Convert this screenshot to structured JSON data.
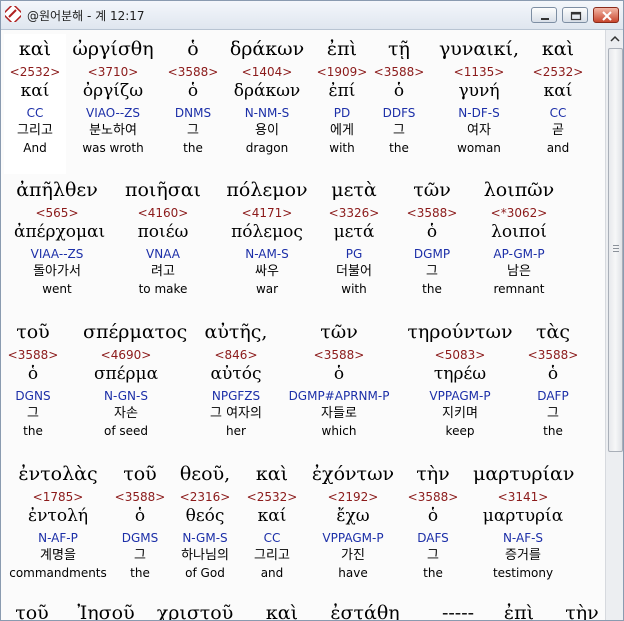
{
  "window": {
    "title": "@원어분해 - 계 12:17",
    "buttons": [
      "minimize",
      "maximize",
      "close"
    ]
  },
  "rows": [
    {
      "words": [
        {
          "greek": "καὶ",
          "strong": "<2532>",
          "lemma": "καί",
          "parse": "CC",
          "korean": "그리고",
          "english": "And",
          "highlight": true
        },
        {
          "greek": "ὠργίσθη",
          "strong": "<3710>",
          "lemma": "ὀργίζω",
          "parse": "VIAO--ZS",
          "korean": "분노하여",
          "english": "was wroth"
        },
        {
          "greek": "ὁ",
          "strong": "<3588>",
          "lemma": "ὁ",
          "parse": "DNMS",
          "korean": "그",
          "english": "the"
        },
        {
          "greek": "δράκων",
          "strong": "<1404>",
          "lemma": "δράκων",
          "parse": "N-NM-S",
          "korean": "용이",
          "english": "dragon"
        },
        {
          "greek": "ἐπὶ",
          "strong": "<1909>",
          "lemma": "ἐπί",
          "parse": "PD",
          "korean": "에게",
          "english": "with"
        },
        {
          "greek": "τῇ",
          "strong": "<3588>",
          "lemma": "ὁ",
          "parse": "DDFS",
          "korean": "그",
          "english": "the"
        },
        {
          "greek": "γυναικί,",
          "strong": "<1135>",
          "lemma": "γυνή",
          "parse": "N-DF-S",
          "korean": "여자",
          "english": "woman"
        },
        {
          "greek": "καὶ",
          "strong": "<2532>",
          "lemma": "καί",
          "parse": "CC",
          "korean": "곧",
          "english": "and"
        }
      ]
    },
    {
      "words": [
        {
          "greek": "ἀπῆλθεν",
          "strong": "<565>",
          "lemma": "ἀπέρχομαι",
          "parse": "VIAA--ZS",
          "korean": "돌아가서",
          "english": "went"
        },
        {
          "greek": "ποιῆσαι",
          "strong": "<4160>",
          "lemma": "ποιέω",
          "parse": "VNAA",
          "korean": "려고",
          "english": "to make"
        },
        {
          "greek": "πόλεμον",
          "strong": "<4171>",
          "lemma": "πόλεμος",
          "parse": "N-AM-S",
          "korean": "싸우",
          "english": "war"
        },
        {
          "greek": "μετὰ",
          "strong": "<3326>",
          "lemma": "μετά",
          "parse": "PG",
          "korean": "더불어",
          "english": "with"
        },
        {
          "greek": "τῶν",
          "strong": "<3588>",
          "lemma": "ὁ",
          "parse": "DGMP",
          "korean": "그",
          "english": "the"
        },
        {
          "greek": "λοιπῶν",
          "strong": "<*3062>",
          "lemma": "λοιποί",
          "parse": "AP-GM-P",
          "korean": "남은",
          "english": "remnant"
        }
      ]
    },
    {
      "words": [
        {
          "greek": "τοῦ",
          "strong": "<3588>",
          "lemma": "ὁ",
          "parse": "DGNS",
          "korean": "그",
          "english": "the"
        },
        {
          "greek": "σπέρματος",
          "strong": "<4690>",
          "lemma": "σπέρμα",
          "parse": "N-GN-S",
          "korean": "자손",
          "english": "of seed"
        },
        {
          "greek": "αὐτῆς,",
          "strong": "<846>",
          "lemma": "αὐτός",
          "parse": "NPGFZS",
          "korean": "그 여자의",
          "english": "her"
        },
        {
          "greek": "τῶν",
          "strong": "<3588>",
          "lemma": "ὁ",
          "parse": "DGMP#APRNM-P",
          "korean": "자들로",
          "english": "which"
        },
        {
          "greek": "τηρούντων",
          "strong": "<5083>",
          "lemma": "τηρέω",
          "parse": "VPPAGM-P",
          "korean": "지키며",
          "english": "keep"
        },
        {
          "greek": "τὰς",
          "strong": "<3588>",
          "lemma": "ὁ",
          "parse": "DAFP",
          "korean": "그",
          "english": "the"
        }
      ]
    },
    {
      "words": [
        {
          "greek": "ἐντολὰς",
          "strong": "<1785>",
          "lemma": "ἐντολή",
          "parse": "N-AF-P",
          "korean": "계명을",
          "english": "commandments"
        },
        {
          "greek": "τοῦ",
          "strong": "<3588>",
          "lemma": "ὁ",
          "parse": "DGMS",
          "korean": "그",
          "english": "the"
        },
        {
          "greek": "θεοῦ,",
          "strong": "<2316>",
          "lemma": "θεός",
          "parse": "N-GM-S",
          "korean": "하나님의",
          "english": "of God"
        },
        {
          "greek": "καὶ",
          "strong": "<2532>",
          "lemma": "καί",
          "parse": "CC",
          "korean": "그리고",
          "english": "and"
        },
        {
          "greek": "ἐχόντων",
          "strong": "<2192>",
          "lemma": "ἔχω",
          "parse": "VPPAGM-P",
          "korean": "가진",
          "english": "have"
        },
        {
          "greek": "τὴν",
          "strong": "<3588>",
          "lemma": "ὁ",
          "parse": "DAFS",
          "korean": "그",
          "english": "the"
        },
        {
          "greek": "μαρτυρίαν",
          "strong": "<3141>",
          "lemma": "μαρτυρία",
          "parse": "N-AF-S",
          "korean": "증거를",
          "english": "testimony"
        }
      ]
    },
    {
      "words": [
        {
          "greek": "τοῦ"
        },
        {
          "greek": "Ἰησοῦ"
        },
        {
          "greek": "χριστοῦ"
        },
        {
          "greek": "καὶ"
        },
        {
          "greek": "ἐστάθη"
        },
        {
          "greek": "-----"
        },
        {
          "greek": "ἐπὶ"
        },
        {
          "greek": "τὴν"
        }
      ]
    }
  ]
}
